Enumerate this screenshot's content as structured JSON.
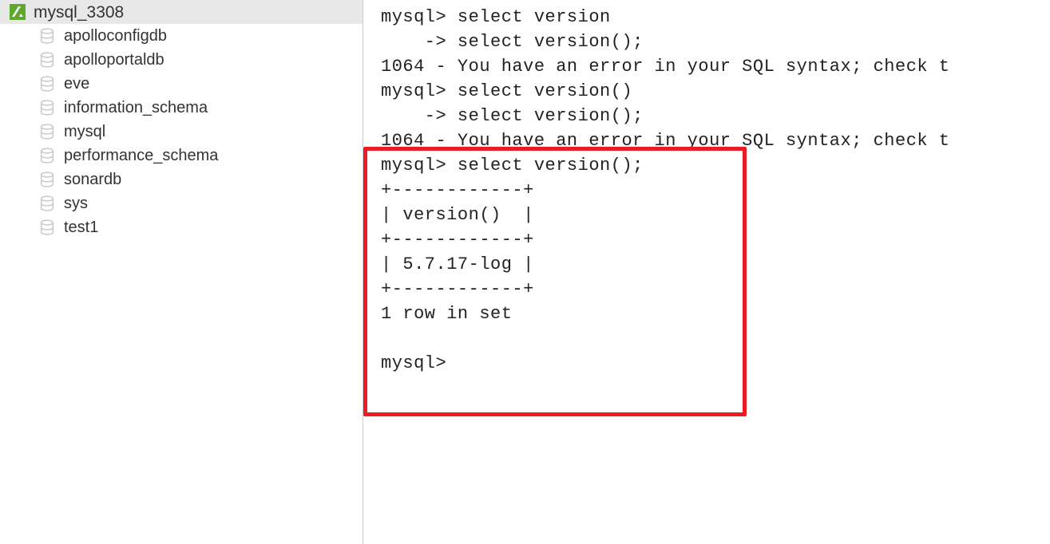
{
  "sidebar": {
    "connection": {
      "label": "mysql_3308"
    },
    "databases": [
      {
        "label": "apolloconfigdb"
      },
      {
        "label": "apolloportaldb"
      },
      {
        "label": "eve"
      },
      {
        "label": "information_schema"
      },
      {
        "label": "mysql"
      },
      {
        "label": "performance_schema"
      },
      {
        "label": "sonardb"
      },
      {
        "label": "sys"
      },
      {
        "label": "test1"
      }
    ]
  },
  "console": {
    "lines": [
      "mysql> select version",
      "    -> select version();",
      "1064 - You have an error in your SQL syntax; check t",
      "mysql> select version()",
      "    -> select version();",
      "1064 - You have an error in your SQL syntax; check t",
      "mysql> select version();",
      "+------------+",
      "| version()  |",
      "+------------+",
      "| 5.7.17-log |",
      "+------------+",
      "1 row in set",
      "",
      "mysql> "
    ]
  }
}
